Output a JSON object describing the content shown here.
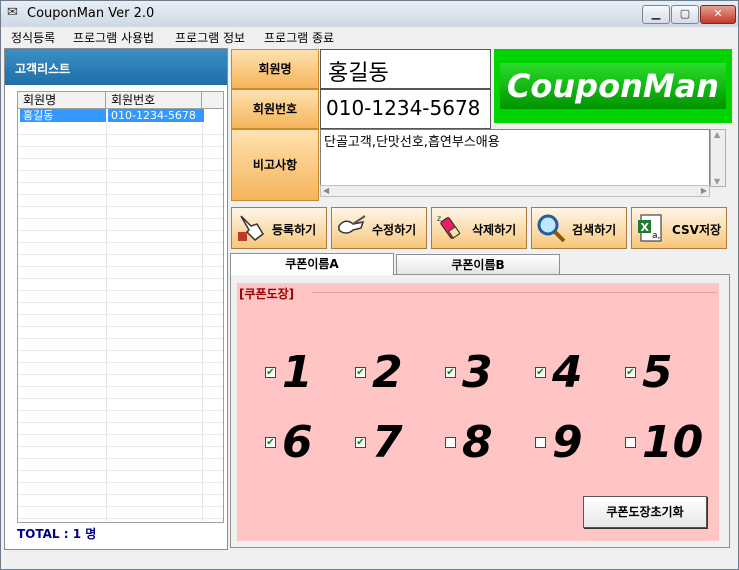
{
  "window": {
    "title": "CouponMan Ver 2.0"
  },
  "menu": [
    "정식등록",
    "프로그램 사용법",
    "프로그램 정보",
    "프로그램 종료"
  ],
  "customer_list": {
    "header": "고객리스트",
    "columns": [
      "회원명",
      "회원번호"
    ],
    "rows": [
      {
        "name": "홍길동",
        "number": "010-1234-5678"
      }
    ],
    "total": "TOTAL : 1 명"
  },
  "form": {
    "name_label": "회원명",
    "name_value": "홍길동",
    "number_label": "회원번호",
    "number_value": "010-1234-5678",
    "memo_label": "비고사항",
    "memo_value": "단골고객,단맛선호,흡연부스애용"
  },
  "logo": {
    "text": "CouponMan",
    "color": "#00d400"
  },
  "toolbar": {
    "register": "등록하기",
    "edit": "수정하기",
    "delete": "삭제하기",
    "search": "검색하기",
    "csv": "CSV저장"
  },
  "tabs": [
    {
      "label": "쿠폰이름A",
      "active": true
    },
    {
      "label": "쿠폰이름B",
      "active": false
    }
  ],
  "coupon": {
    "group_title": "[쿠폰도장]",
    "stamps": [
      {
        "number": "1",
        "checked": true
      },
      {
        "number": "2",
        "checked": true
      },
      {
        "number": "3",
        "checked": true
      },
      {
        "number": "4",
        "checked": true
      },
      {
        "number": "5",
        "checked": true
      },
      {
        "number": "6",
        "checked": true
      },
      {
        "number": "7",
        "checked": true
      },
      {
        "number": "8",
        "checked": false
      },
      {
        "number": "9",
        "checked": false
      },
      {
        "number": "10",
        "checked": false
      }
    ],
    "reset_label": "쿠폰도장초기화",
    "background_color": "#ffc4c4"
  }
}
